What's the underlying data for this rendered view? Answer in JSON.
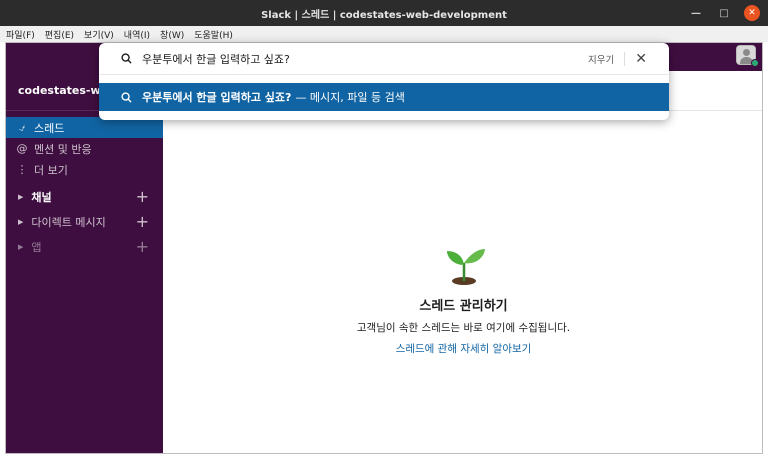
{
  "window": {
    "title": "Slack | 스레드 | codestates-web-development"
  },
  "menu": [
    "파일(F)",
    "편집(E)",
    "보기(V)",
    "내역(I)",
    "창(W)",
    "도움말(H)"
  ],
  "workspace": {
    "name": "codestates-web-..."
  },
  "nav": [
    {
      "label": "스레드",
      "icon": "threads-icon"
    },
    {
      "label": "멘션 및 반응",
      "icon": "at-icon"
    },
    {
      "label": "더 보기",
      "icon": "more-icon"
    }
  ],
  "sections": [
    {
      "label": "채널"
    },
    {
      "label": "다이렉트 메시지"
    },
    {
      "label": "앱"
    }
  ],
  "search": {
    "query": "우분투에서 한글 입력하고 싶죠?",
    "clear_label": "지우기",
    "suggestion_query": "우분투에서 한글 입력하고 싶죠?",
    "suggestion_hint": "— 메시지, 파일 등 검색"
  },
  "empty_state": {
    "title": "스레드 관리하기",
    "description": "고객님이 속한 스레드는 바로 여기에 수집됩니다.",
    "link": "스레드에 관해 자세히 알아보기"
  },
  "colors": {
    "sidebar": "#3f0e40",
    "accent": "#1164a3",
    "presence": "#2bac76",
    "window_close": "#e95420"
  }
}
